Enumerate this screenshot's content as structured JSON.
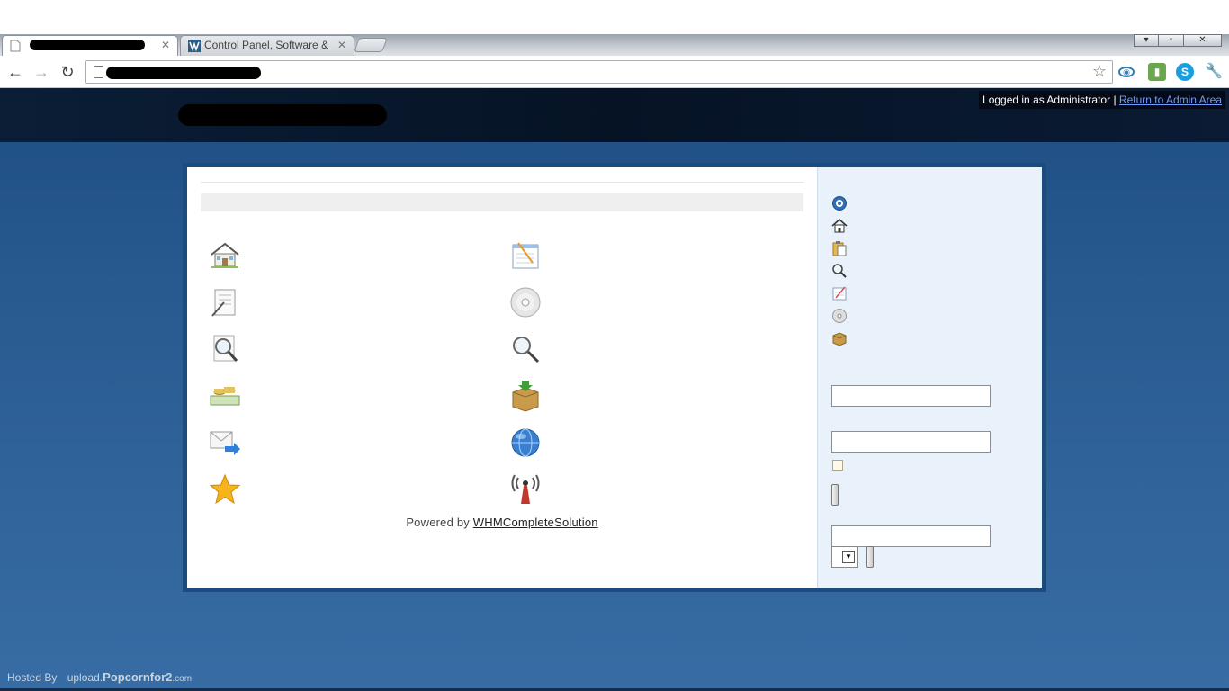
{
  "browser": {
    "tabs": [
      {
        "label": "",
        "active": true,
        "redacted": true
      },
      {
        "label": "Control Panel, Software &",
        "active": false
      }
    ],
    "window_controls": [
      "minimize",
      "restore",
      "close"
    ],
    "address_bar": {
      "value": "",
      "redacted": true
    },
    "extensions": [
      "feedly-icon",
      "evernote-icon",
      "skype-icon",
      "wrench-icon"
    ]
  },
  "header": {
    "logo_redacted": true,
    "admin_bar": {
      "status": "Logged in as Administrator",
      "separator": "|",
      "link": "Return to Admin Area"
    }
  },
  "main": {
    "icons_left": [
      "home-icon",
      "document-edit-icon",
      "search-document-icon",
      "money-icon",
      "email-forward-icon",
      "star-icon"
    ],
    "icons_right": [
      "notepad-icon",
      "cd-icon",
      "magnifier-icon",
      "package-download-icon",
      "globe-icon",
      "antenna-icon"
    ],
    "powered_by": {
      "prefix": "Powered by ",
      "link": "WHMCompleteSolution"
    }
  },
  "sidebar": {
    "icons": [
      "help-icon",
      "home-icon",
      "clipboard-icon",
      "magnifier-icon",
      "notepad-icon",
      "cd-icon",
      "package-icon"
    ],
    "inputs": [
      {
        "value": "",
        "placeholder": ""
      },
      {
        "value": "",
        "placeholder": ""
      },
      {
        "value": "",
        "placeholder": ""
      }
    ],
    "select_value": ""
  },
  "footer": {
    "hosted_by": "Hosted By",
    "host_prefix": "upload.",
    "host_brand": "Popcornfor2",
    "host_suffix": ".com"
  },
  "colors": {
    "header": "#061325",
    "page_gradient_top": "#1e4e83",
    "page_gradient_bottom": "#376da4",
    "sidebar_bg": "#e9f1fa",
    "admin_link": "#6f9bff"
  }
}
